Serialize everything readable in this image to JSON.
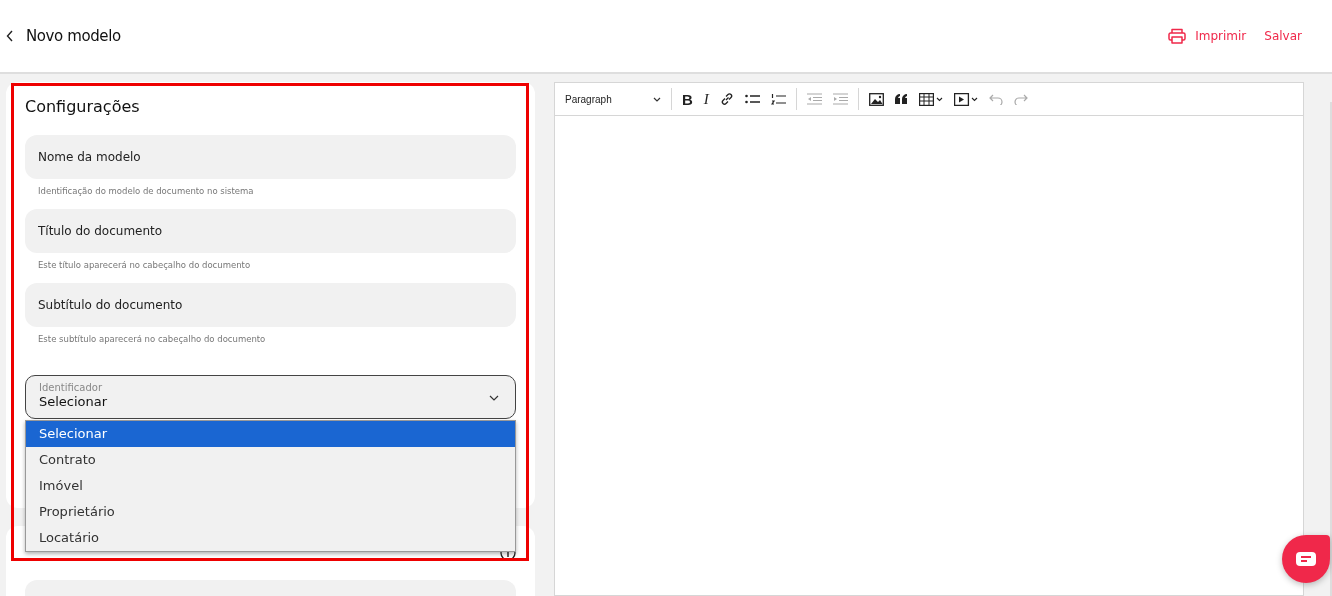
{
  "header": {
    "title": "Novo modelo",
    "actions": [
      {
        "kind": "print",
        "label": "Imprimir"
      },
      {
        "kind": "save",
        "label": "Salvar"
      }
    ]
  },
  "config": {
    "title": "Configurações",
    "highlighted": true,
    "fields": [
      {
        "placeholder": "Nome da modelo",
        "hint": "Identificação do modelo de documento no sistema"
      },
      {
        "placeholder": "Título do documento",
        "hint": "Este título aparecerá no cabeçalho do documento"
      },
      {
        "placeholder": "Subtítulo do documento",
        "hint": "Este subtítulo aparecerá no cabeçalho do documento"
      }
    ],
    "select": {
      "label": "Identificador",
      "value": "Selecionar",
      "expanded": true,
      "options": [
        {
          "label": "Selecionar",
          "selected": true
        },
        {
          "label": "Contrato",
          "selected": false
        },
        {
          "label": "Imóvel",
          "selected": false
        },
        {
          "label": "Proprietário",
          "selected": false
        },
        {
          "label": "Locatário",
          "selected": false
        }
      ]
    }
  },
  "editor": {
    "block_format": "Paragraph",
    "tools": [
      {
        "kind": "sep"
      },
      {
        "kind": "bold",
        "label": "B",
        "disabled": false
      },
      {
        "kind": "italic",
        "label": "I",
        "disabled": false
      },
      {
        "kind": "link",
        "disabled": false
      },
      {
        "kind": "bullets",
        "disabled": false
      },
      {
        "kind": "numbers",
        "disabled": false
      },
      {
        "kind": "sep"
      },
      {
        "kind": "outdent",
        "disabled": true
      },
      {
        "kind": "indent",
        "disabled": true
      },
      {
        "kind": "sep"
      },
      {
        "kind": "image",
        "disabled": false
      },
      {
        "kind": "quote",
        "disabled": false
      },
      {
        "kind": "table",
        "disabled": false
      },
      {
        "kind": "media",
        "disabled": false
      },
      {
        "kind": "undo",
        "disabled": true
      },
      {
        "kind": "redo",
        "disabled": true
      }
    ]
  }
}
